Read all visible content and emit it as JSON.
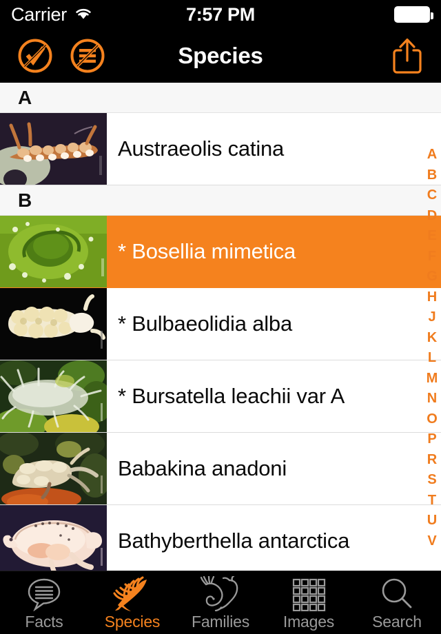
{
  "status_bar": {
    "carrier": "Carrier",
    "wifi_icon": "wifi-icon",
    "time": "7:57 PM",
    "battery_icon": "battery-full-icon"
  },
  "nav_bar": {
    "title": "Species",
    "left_buttons": [
      {
        "name": "no-checkmark-button",
        "icon": "circle-slash-checkmark-icon"
      },
      {
        "name": "no-list-button",
        "icon": "circle-slash-list-icon"
      }
    ],
    "right_button": {
      "name": "share-button",
      "icon": "share-up-arrow-icon"
    }
  },
  "colors": {
    "accent": "#f5821e",
    "index_text": "#f07c1e",
    "selected_row_bg": "#f5821e",
    "section_header_bg": "#f7f7f7",
    "bar_background": "#000000",
    "inactive_tab": "#9a9a9a"
  },
  "list": {
    "sections": [
      {
        "header": "A",
        "rows": [
          {
            "label": "Austraeolis catina",
            "selected": false,
            "thumb": "thumb-austraeolis"
          }
        ]
      },
      {
        "header": "B",
        "rows": [
          {
            "label": "* Bosellia mimetica",
            "selected": true,
            "thumb": "thumb-bosellia"
          },
          {
            "label": "* Bulbaeolidia alba",
            "selected": false,
            "thumb": "thumb-bulbaeolidia"
          },
          {
            "label": "* Bursatella leachii var A",
            "selected": false,
            "thumb": "thumb-bursatella"
          },
          {
            "label": "Babakina anadoni",
            "selected": false,
            "thumb": "thumb-babakina"
          },
          {
            "label": "Bathyberthella antarctica",
            "selected": false,
            "thumb": "thumb-bathyberthella"
          }
        ]
      }
    ]
  },
  "index_bar": {
    "letters": [
      "A",
      "B",
      "C",
      "D",
      "E",
      "F",
      "G",
      "H",
      "J",
      "K",
      "L",
      "M",
      "N",
      "O",
      "P",
      "R",
      "S",
      "T",
      "U",
      "V"
    ]
  },
  "tab_bar": {
    "tabs": [
      {
        "label": "Facts",
        "icon": "speech-bubble-icon",
        "active": false
      },
      {
        "label": "Species",
        "icon": "nudibranch-icon",
        "active": true
      },
      {
        "label": "Families",
        "icon": "two-slugs-icon",
        "active": false
      },
      {
        "label": "Images",
        "icon": "grid-icon",
        "active": false
      },
      {
        "label": "Search",
        "icon": "magnifier-icon",
        "active": false
      }
    ]
  }
}
